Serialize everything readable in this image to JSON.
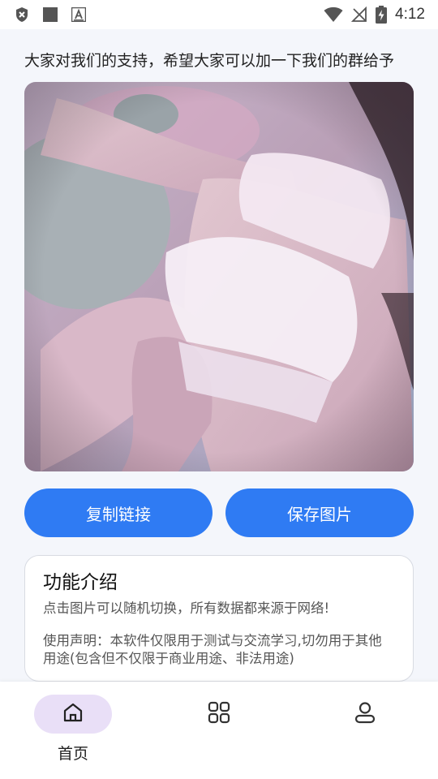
{
  "status_bar": {
    "time": "4:12",
    "left_icons": [
      "shield-x-icon",
      "square-icon",
      "font-a-icon"
    ],
    "right_icons": [
      "wifi-icon",
      "no-signal-icon",
      "battery-charging-icon"
    ]
  },
  "marquee": {
    "text": "大家对我们的支持，希望大家可以加一下我们的群给予"
  },
  "image": {
    "alt": "random photo"
  },
  "buttons": {
    "copy_label": "复制链接",
    "save_label": "保存图片",
    "accent_color": "#2f7bf3"
  },
  "info_card": {
    "title": "功能介绍",
    "line1": "点击图片可以随机切换，所有数据都来源于网络!",
    "line2": "使用声明：本软件仅限用于测试与交流学习,切勿用于其他用途(包含但不仅限于商业用途、非法用途)"
  },
  "bottom_nav": {
    "items": [
      {
        "label": "首页",
        "icon": "home-icon",
        "active": true
      },
      {
        "label": "",
        "icon": "grid-icon",
        "active": false
      },
      {
        "label": "",
        "icon": "person-icon",
        "active": false
      }
    ]
  }
}
